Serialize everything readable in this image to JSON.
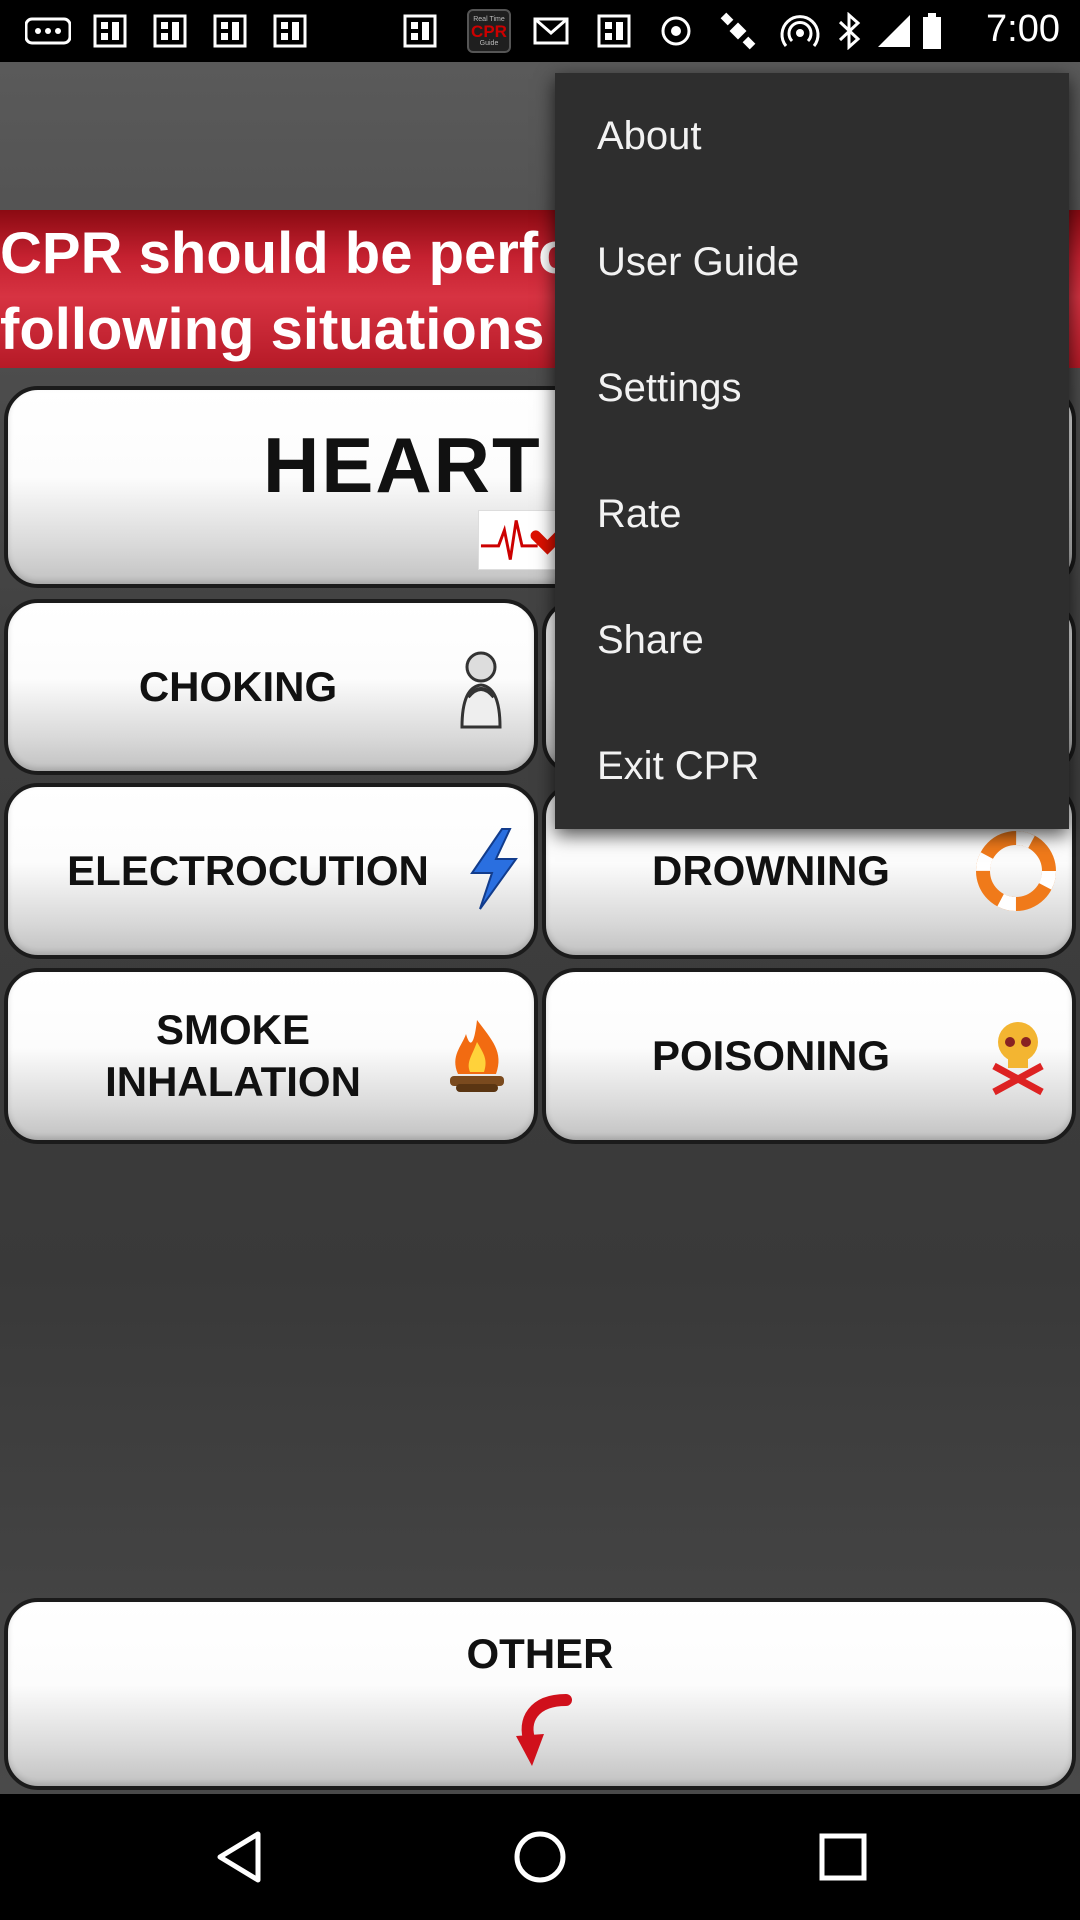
{
  "status_bar": {
    "time": "7:00",
    "icons": [
      "more-icon",
      "image-icon",
      "cpr-app-icon",
      "mail-icon",
      "image-icon",
      "sync-icon",
      "satellite-icon",
      "wifi-hotspot-icon",
      "bluetooth-icon",
      "signal-icon",
      "battery-icon"
    ],
    "app_badge_top": "Real Time",
    "app_badge_main": "CPR",
    "app_badge_bottom": "Guide"
  },
  "banner": {
    "line1": "CPR should be perfo",
    "line2": "following situations"
  },
  "cards": {
    "heart": "HEART A",
    "choking": "CHOKING",
    "electrocution": "ELECTROCUTION",
    "drowning": "DROWNING",
    "smoke_line1": "SMOKE",
    "smoke_line2": "INHALATION",
    "poisoning": "POISONING",
    "other": "OTHER"
  },
  "menu": {
    "items": [
      "About",
      "User Guide",
      "Settings",
      "Rate",
      "Share",
      "Exit CPR"
    ]
  },
  "colors": {
    "banner_red": "#c52130",
    "menu_bg": "#2e2e2e",
    "arrow_red": "#d0101b",
    "bolt_blue": "#2a6fe0"
  }
}
